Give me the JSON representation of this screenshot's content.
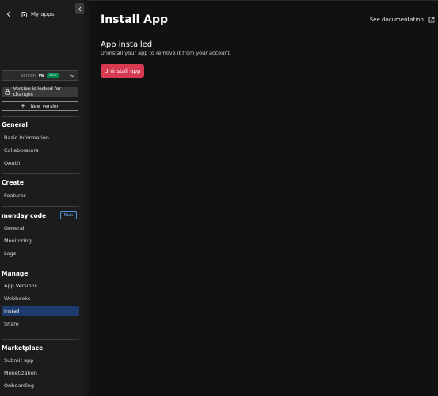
{
  "header": {
    "back_label": "My apps"
  },
  "version": {
    "prefix": "Version:",
    "number": "v6",
    "status": "Live"
  },
  "locked_text": "Version is locked for changes",
  "new_version_label": "New version",
  "sections": {
    "general": {
      "title": "General",
      "items": [
        "Basic Information",
        "Collaborators",
        "OAuth"
      ]
    },
    "create": {
      "title": "Create",
      "items": [
        "Features"
      ]
    },
    "monday_code": {
      "title": "monday code",
      "badge": "New",
      "items": [
        "General",
        "Monitoring",
        "Logs"
      ]
    },
    "manage": {
      "title": "Manage",
      "items": [
        "App Versions",
        "Webhooks",
        "Install",
        "Share"
      ],
      "active": "Install"
    },
    "marketplace": {
      "title": "Marketplace",
      "items": [
        "Submit app",
        "Monetization",
        "Onboarding"
      ]
    }
  },
  "main": {
    "title": "Install App",
    "docs_link": "See documentation",
    "installed_title": "App installed",
    "installed_desc": "Uninstall your app to remove it from your account.",
    "uninstall_label": "Uninstall app"
  },
  "colors": {
    "accent_danger": "#d83a52",
    "active_nav": "#1d3b6e",
    "live_badge": "#00854d",
    "new_badge": "#4c8fe0"
  },
  "icons": {
    "back": "chevron-left-icon",
    "apps": "apps-icon",
    "collapse": "chevron-left-icon",
    "lock": "lock-icon",
    "external": "external-link-icon"
  }
}
